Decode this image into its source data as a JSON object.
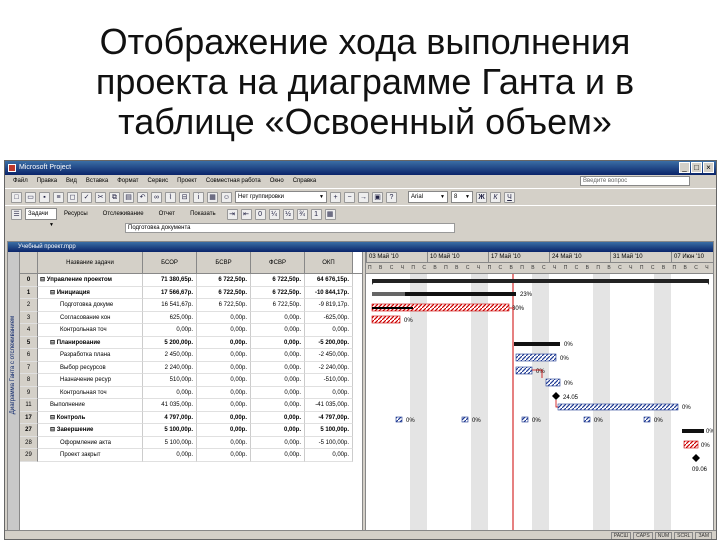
{
  "slide": {
    "title_lines": [
      "Отображение хода выполнения",
      "проекта на диаграмме Ганта и в",
      "таблице «Освоенный объем»"
    ]
  },
  "window": {
    "title": "Microsoft Project",
    "document_title": "Учебный проект.mpp",
    "view_bar_label": "Диаграмма Ганта с отслеживанием"
  },
  "menu": {
    "items": [
      "Файл",
      "Правка",
      "Вид",
      "Вставка",
      "Формат",
      "Сервис",
      "Проект",
      "Совместная работа",
      "Окно",
      "Справка"
    ],
    "help_placeholder": "Введите вопрос"
  },
  "toolbar": {
    "no_group_label": "Нет группировки",
    "font_name": "Arial",
    "font_size": "8",
    "tasks_label": "Задачи",
    "resources_label": "Ресурсы",
    "tracking_label": "Отслеживание",
    "report_label": "Отчет",
    "show_label": "Показать",
    "entry_value": "Подготовка документа"
  },
  "table": {
    "headers": [
      "",
      "Название задачи",
      "БСОР",
      "БСВР",
      "ФСВР",
      "ОКП"
    ],
    "rows": [
      {
        "id": "0",
        "name": "⊟ Управление проектом",
        "bsor": "71 380,65р.",
        "bsvr": "6 722,50р.",
        "fsvr": "6 722,50р.",
        "okp": "64 676,15р."
      },
      {
        "id": "1",
        "name": "⊟ Инициация",
        "bsor": "17 566,67р.",
        "bsvr": "6 722,50р.",
        "fsvr": "6 722,50р.",
        "okp": "-10 844,17р."
      },
      {
        "id": "2",
        "name": "Подготовка докуме",
        "bsor": "16 541,67р.",
        "bsvr": "6 722,50р.",
        "fsvr": "6 722,50р.",
        "okp": "-9 819,17р."
      },
      {
        "id": "3",
        "name": "Согласование кон",
        "bsor": "625,00р.",
        "bsvr": "0,00р.",
        "fsvr": "0,00р.",
        "okp": "-625,00р."
      },
      {
        "id": "4",
        "name": "Контрольная точ",
        "bsor": "0,00р.",
        "bsvr": "0,00р.",
        "fsvr": "0,00р.",
        "okp": "0,00р."
      },
      {
        "id": "5",
        "name": "⊟ Планирование",
        "bsor": "5 200,00р.",
        "bsvr": "0,00р.",
        "fsvr": "0,00р.",
        "okp": "-5 200,00р."
      },
      {
        "id": "6",
        "name": "Разработка плана",
        "bsor": "2 450,00р.",
        "bsvr": "0,00р.",
        "fsvr": "0,00р.",
        "okp": "-2 450,00р."
      },
      {
        "id": "7",
        "name": "Выбор ресурсов",
        "bsor": "2 240,00р.",
        "bsvr": "0,00р.",
        "fsvr": "0,00р.",
        "okp": "-2 240,00р."
      },
      {
        "id": "8",
        "name": "Назначение ресур",
        "bsor": "510,00р.",
        "bsvr": "0,00р.",
        "fsvr": "0,00р.",
        "okp": "-510,00р."
      },
      {
        "id": "9",
        "name": "Контрольная точ",
        "bsor": "0,00р.",
        "bsvr": "0,00р.",
        "fsvr": "0,00р.",
        "okp": "0,00р."
      },
      {
        "id": "11",
        "name": "Выполнение",
        "bsor": "41 035,00р.",
        "bsvr": "0,00р.",
        "fsvr": "0,00р.",
        "okp": "-41 035,00р."
      },
      {
        "id": "17",
        "name": "⊟ Контроль",
        "bsor": "4 797,00р.",
        "bsvr": "0,00р.",
        "fsvr": "0,00р.",
        "okp": "-4 797,00р."
      },
      {
        "id": "27",
        "name": "⊟ Завершение",
        "bsor": "5 100,00р.",
        "bsvr": "0,00р.",
        "fsvr": "0,00р.",
        "okp": "5 100,00р."
      },
      {
        "id": "28",
        "name": "Оформление акта",
        "bsor": "5 100,00р.",
        "bsvr": "0,00р.",
        "fsvr": "0,00р.",
        "okp": "-5 100,00р."
      },
      {
        "id": "29",
        "name": "Проект закрыт",
        "bsor": "0,00р.",
        "bsvr": "0,00р.",
        "fsvr": "0,00р.",
        "okp": "0,00р."
      }
    ]
  },
  "gantt": {
    "weeks": [
      "03 Май '10",
      "10 Май '10",
      "17 Май '10",
      "24 Май '10",
      "31 Май '10",
      "07 Июн '10"
    ],
    "day_letters": "П В С Ч П С В П В С Ч П С В П В С Ч П С В П В С Ч П С В П В С Ч П С В П В С Ч",
    "labels": {
      "summary0": "",
      "summary1": "23%",
      "task2": "30%",
      "task3": "0%",
      "plan_summary": "0%",
      "task6": "0%",
      "task7": "0%",
      "task8": "0%",
      "m9": "24.05",
      "exec": "0%",
      "ctrl_a": "0%",
      "ctrl_b": "0%",
      "ctrl_c": "0%",
      "ctrl_d": "0%",
      "ctrl_e": "0%",
      "fin": "0%",
      "act": "0%",
      "end_date": "09.06"
    }
  },
  "status": {
    "cells": [
      "РАСШ",
      "CAPS",
      "NUM",
      "SCRL",
      "ЗАМ"
    ]
  },
  "colors": {
    "title_bar": "#0a246a",
    "progress": "#000000",
    "baseline_red": "#cc0000",
    "hatched_blue": "#1f3a93"
  }
}
